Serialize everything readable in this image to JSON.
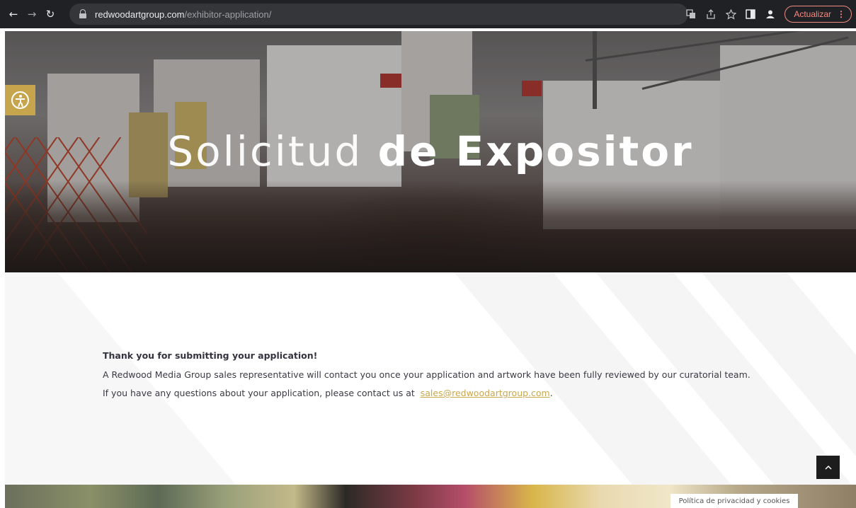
{
  "browser": {
    "back_icon": "back-arrow-icon",
    "forward_icon": "forward-arrow-icon",
    "reload_icon": "reload-icon",
    "url_domain": "redwoodartgroup.com",
    "url_path": "/exhibitor-application/",
    "update_label": "Actualizar"
  },
  "hero": {
    "title_light": "Solicitud",
    "title_bold": "de Expositor"
  },
  "message": {
    "heading": "Thank you for submitting your application!",
    "line1": "A Redwood Media Group sales representative will contact you once your application and artwork have been fully reviewed by our curatorial team.",
    "line2_prefix": "If you have any questions about your application, please contact us at",
    "email": "sales@redwoodartgroup.com",
    "line2_suffix": "."
  },
  "footer": {
    "privacy_label": "Política de privacidad y cookies"
  },
  "colors": {
    "accent_gold": "#c7a54c",
    "link_gold": "#c9a74d",
    "update_red": "#f28b82"
  }
}
